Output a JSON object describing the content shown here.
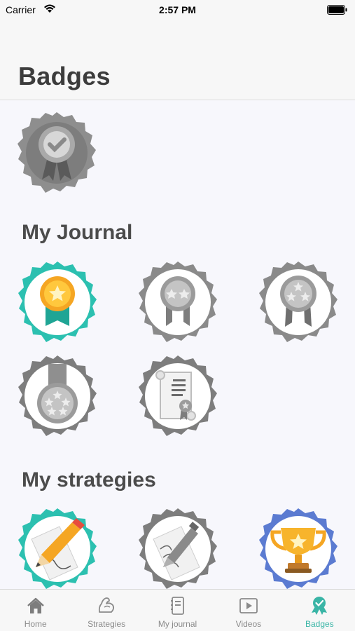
{
  "status_bar": {
    "carrier": "Carrier",
    "time": "2:57 PM"
  },
  "header": {
    "title": "Badges"
  },
  "sections": {
    "journal": {
      "title": "My Journal"
    },
    "strategies": {
      "title": "My strategies"
    }
  },
  "colors": {
    "accent": "#3ab5a6",
    "inactive": "#8a8a8a",
    "gold": "#f7b42c",
    "blue": "#5b7bd1"
  },
  "badges": [
    {
      "icon": "ribbon-check-icon",
      "earned": false
    },
    {
      "icon": "ribbon-one-star-icon",
      "earned": true
    },
    {
      "icon": "ribbon-two-stars-icon",
      "earned": false
    },
    {
      "icon": "ribbon-three-stars-icon",
      "earned": false
    },
    {
      "icon": "medal-five-stars-icon",
      "earned": false
    },
    {
      "icon": "certificate-icon",
      "earned": false
    },
    {
      "icon": "pencil-paper-icon",
      "earned": true
    },
    {
      "icon": "pen-paper-icon",
      "earned": false
    },
    {
      "icon": "trophy-icon",
      "earned": true
    }
  ],
  "tabs": [
    {
      "label": "Home",
      "icon": "home-icon",
      "active": false
    },
    {
      "label": "Strategies",
      "icon": "strategies-icon",
      "active": false
    },
    {
      "label": "My journal",
      "icon": "journal-icon",
      "active": false
    },
    {
      "label": "Videos",
      "icon": "videos-icon",
      "active": false
    },
    {
      "label": "Badges",
      "icon": "badges-icon",
      "active": true
    }
  ]
}
